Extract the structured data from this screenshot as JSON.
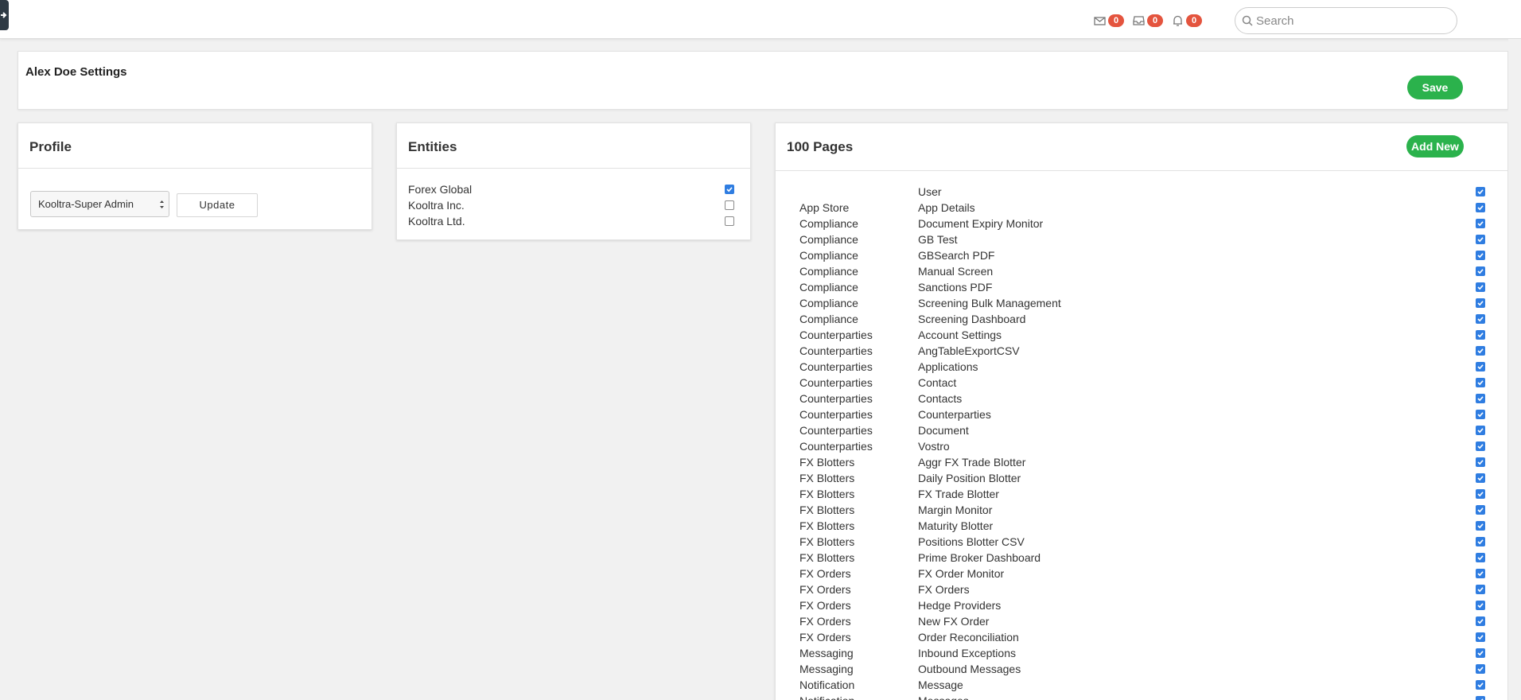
{
  "topbar": {
    "mail_count": "0",
    "inbox_count": "0",
    "bell_count": "0",
    "search_placeholder": "Search",
    "search_value": ""
  },
  "settings": {
    "title": "Alex Doe Settings",
    "save_label": "Save"
  },
  "profile": {
    "title": "Profile",
    "selected_role": "Kooltra-Super Admin",
    "update_label": "Update"
  },
  "entities": {
    "title": "Entities",
    "items": [
      {
        "label": "Forex Global",
        "checked": true
      },
      {
        "label": "Kooltra Inc.",
        "checked": false
      },
      {
        "label": "Kooltra Ltd.",
        "checked": false
      }
    ]
  },
  "pages": {
    "title": "100 Pages",
    "add_label": "Add New",
    "rows": [
      {
        "category": "",
        "page": "User",
        "checked": true
      },
      {
        "category": "App Store",
        "page": "App Details",
        "checked": true
      },
      {
        "category": "Compliance",
        "page": "Document Expiry Monitor",
        "checked": true
      },
      {
        "category": "Compliance",
        "page": "GB Test",
        "checked": true
      },
      {
        "category": "Compliance",
        "page": "GBSearch PDF",
        "checked": true
      },
      {
        "category": "Compliance",
        "page": "Manual Screen",
        "checked": true
      },
      {
        "category": "Compliance",
        "page": "Sanctions PDF",
        "checked": true
      },
      {
        "category": "Compliance",
        "page": "Screening Bulk Management",
        "checked": true
      },
      {
        "category": "Compliance",
        "page": "Screening Dashboard",
        "checked": true
      },
      {
        "category": "Counterparties",
        "page": "Account Settings",
        "checked": true
      },
      {
        "category": "Counterparties",
        "page": "AngTableExportCSV",
        "checked": true
      },
      {
        "category": "Counterparties",
        "page": "Applications",
        "checked": true
      },
      {
        "category": "Counterparties",
        "page": "Contact",
        "checked": true
      },
      {
        "category": "Counterparties",
        "page": "Contacts",
        "checked": true
      },
      {
        "category": "Counterparties",
        "page": "Counterparties",
        "checked": true
      },
      {
        "category": "Counterparties",
        "page": "Document",
        "checked": true
      },
      {
        "category": "Counterparties",
        "page": "Vostro",
        "checked": true
      },
      {
        "category": "FX Blotters",
        "page": "Aggr FX Trade Blotter",
        "checked": true
      },
      {
        "category": "FX Blotters",
        "page": "Daily Position Blotter",
        "checked": true
      },
      {
        "category": "FX Blotters",
        "page": "FX Trade Blotter",
        "checked": true
      },
      {
        "category": "FX Blotters",
        "page": "Margin Monitor",
        "checked": true
      },
      {
        "category": "FX Blotters",
        "page": "Maturity Blotter",
        "checked": true
      },
      {
        "category": "FX Blotters",
        "page": "Positions Blotter CSV",
        "checked": true
      },
      {
        "category": "FX Blotters",
        "page": "Prime Broker Dashboard",
        "checked": true
      },
      {
        "category": "FX Orders",
        "page": "FX Order Monitor",
        "checked": true
      },
      {
        "category": "FX Orders",
        "page": "FX Orders",
        "checked": true
      },
      {
        "category": "FX Orders",
        "page": "Hedge Providers",
        "checked": true
      },
      {
        "category": "FX Orders",
        "page": "New FX Order",
        "checked": true
      },
      {
        "category": "FX Orders",
        "page": "Order Reconciliation",
        "checked": true
      },
      {
        "category": "Messaging",
        "page": "Inbound Exceptions",
        "checked": true
      },
      {
        "category": "Messaging",
        "page": "Outbound Messages",
        "checked": true
      },
      {
        "category": "Notification",
        "page": "Message",
        "checked": true
      },
      {
        "category": "Notification",
        "page": "Messages",
        "checked": true
      }
    ]
  },
  "colors": {
    "accent_green": "#2bb24c",
    "badge_red": "#e4543e",
    "checkbox_blue": "#2f7de1"
  }
}
